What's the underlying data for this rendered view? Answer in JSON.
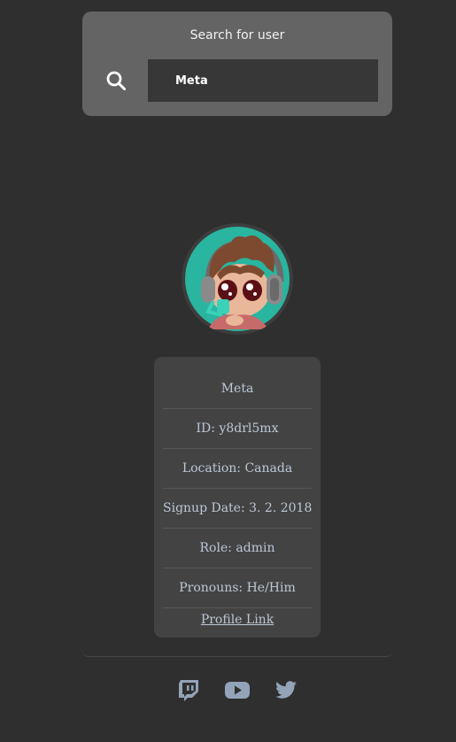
{
  "search": {
    "title": "Search for user",
    "value": "Meta",
    "icon": "search-icon"
  },
  "avatar": {
    "description_icon": "avatar-icon",
    "colors": {
      "background": "#29b5a0",
      "ring": "#3d3d3d"
    }
  },
  "profile": {
    "name": "Meta",
    "id": "ID: y8drl5mx",
    "location": "Location: Canada",
    "signup_date": "Signup Date: 3. 2. 2018",
    "role": "Role: admin",
    "pronouns": "Pronouns: He/Him",
    "link_label": "Profile Link"
  },
  "social": [
    {
      "name": "twitch",
      "icon": "twitch-icon"
    },
    {
      "name": "youtube",
      "icon": "youtube-icon"
    },
    {
      "name": "twitter",
      "icon": "twitter-icon"
    }
  ],
  "colors": {
    "page_bg": "#2f2f2f",
    "panel_bg": "#646464",
    "input_bg": "#373737",
    "card_bg": "#434343",
    "text": "#bcc8d6",
    "icon": "#93a3b8"
  }
}
